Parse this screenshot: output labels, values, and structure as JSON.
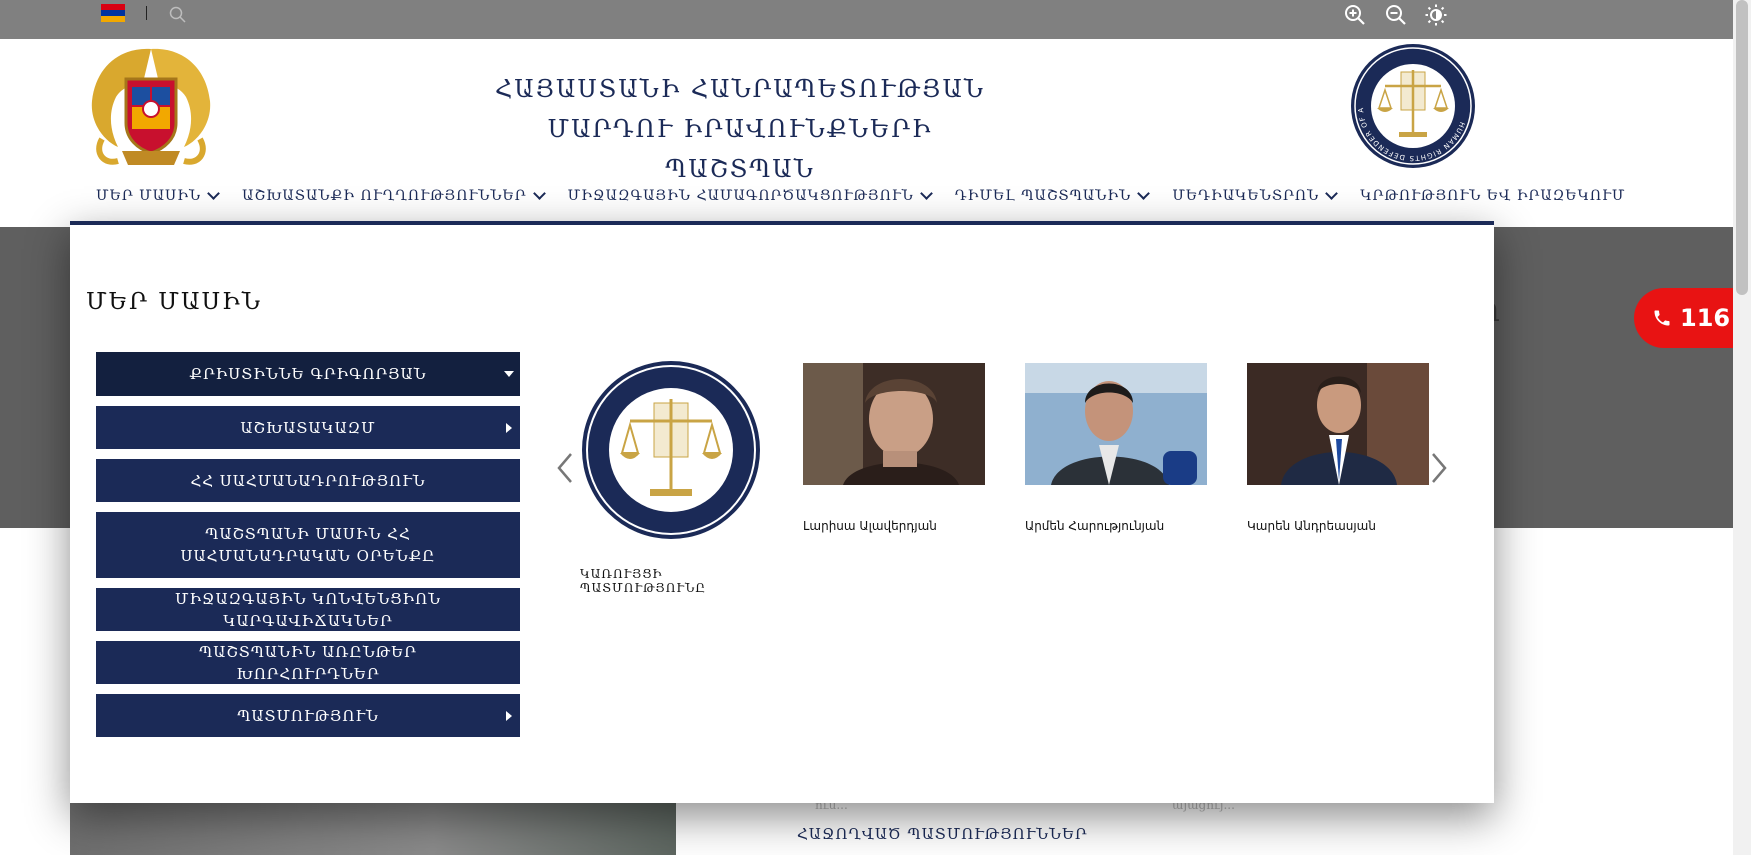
{
  "topbar": {
    "flag_colors": [
      "#d90012",
      "#0033a0",
      "#f2a800"
    ],
    "icons": [
      "search-icon",
      "zoom-in-icon",
      "zoom-out-icon",
      "contrast-icon"
    ]
  },
  "header": {
    "title_line1": "ՀԱՅԱՍՏԱՆԻ ՀԱՆՐԱՊԵՏՈՒԹՅԱՆ",
    "title_line2": "ՄԱՐԴՈՒ ԻՐԱՎՈՒՆՔՆԵՐԻ ՊԱՇՏՊԱՆ",
    "seal_text": "HUMAN RIGHTS DEFENDER OF ARMENIA"
  },
  "nav": {
    "items": [
      {
        "label": "ՄԵՐ ՄԱՍԻՆ"
      },
      {
        "label": "ԱՇԽԱՏԱՆՔԻ ՈՒՂՂՈՒԹՅՈՒՆՆԵՐ"
      },
      {
        "label": "ՄԻՋԱԶԳԱՅԻՆ ՀԱՄԱԳՈՐԾԱԿՑՈՒԹՅՈՒՆ"
      },
      {
        "label": "ԴԻՄԵԼ ՊԱՇՏՊԱՆԻՆ"
      },
      {
        "label": "ՄԵԴԻԱԿԵՆՏՐՈՆ"
      },
      {
        "label": "ԿՐԹՈՒԹՅՈՒՆ ԵՎ ԻՐԱԶԵԿՈՒՄ"
      }
    ]
  },
  "dropdown": {
    "heading": "ՄԵՐ ՄԱՍԻՆ",
    "menu": [
      {
        "label": "ՔՐԻՍՏԻՆՆԵ ԳՐԻԳՈՐՅԱՆ"
      },
      {
        "label": "ԱՇԽԱՏԱԿԱԶՄ"
      },
      {
        "label": "ՀՀ ՍԱՀՄԱՆԱԴՐՈՒԹՅՈՒՆ"
      },
      {
        "label": "ՊԱՇՏՊԱՆԻ ՄԱՍԻՆ ՀՀ ՍԱՀՄԱՆԱԴՐԱԿԱՆ ՕՐԵՆՔԸ"
      },
      {
        "label": "ՄԻՋԱԶԳԱՅԻՆ ԿՈՆՎԵՆՑԻՈՆ ԿԱՐԳԱՎԻՃԱԿՆԵՐ"
      },
      {
        "label": "ՊԱՇՏՊԱՆԻՆ ԱՌԸՆԹԵՐ ԽՈՐՀՈՒՐԴՆԵՐ"
      },
      {
        "label": "ՊԱՏՄՈՒԹՅՈՒՆ"
      }
    ],
    "slides": [
      {
        "caption": "ԿԱՌՈՒՅՑԻ ՊԱՏՄՈՒԹՅՈՒՆԸ"
      },
      {
        "caption": "Լարիսա Ալավերդյան"
      },
      {
        "caption": "Արմեն Հարությունյան"
      },
      {
        "caption": "Կարեն Անդրեասյան"
      }
    ]
  },
  "phone": {
    "number": "116"
  },
  "page_below": {
    "hero_partial": "n",
    "snippet1": "ուս...",
    "snippet2": "այացույ...",
    "section_heading": "ՀԱՋՈՂՎԱԾ ՊԱՏՄՈՒԹՅՈՒՆՆԵՐ"
  },
  "colors": {
    "brand_navy": "#1b2a57",
    "topbar_gray": "#808080",
    "phone_red": "#e81313",
    "seal_gold": "#c9a445"
  }
}
